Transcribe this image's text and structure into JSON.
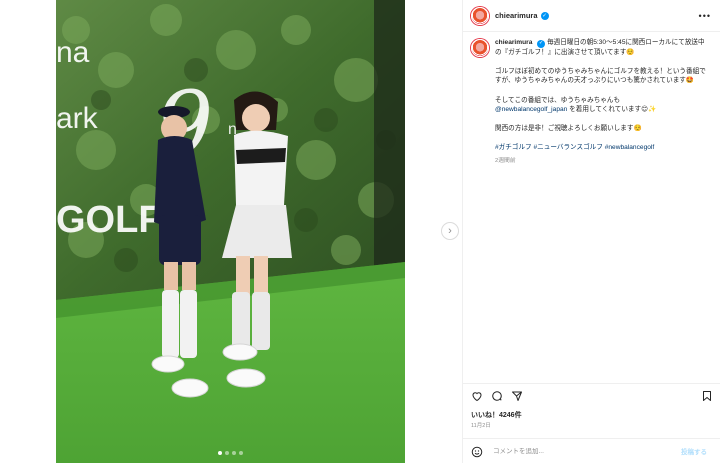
{
  "post": {
    "username": "chiearimura",
    "more_label": "•••",
    "next_label": "›",
    "media_overlay": {
      "line1": "na",
      "line2": "ark",
      "line3": "GOLF",
      "big_number": "9",
      "suffix": "n"
    },
    "carousel": {
      "count": 4,
      "active": 0
    }
  },
  "caption": {
    "username": "chiearimura",
    "line1": "毎週日曜日の朝5:30〜5:45に関西ローカルにて放送中の『ガチゴルフ！』に出演させて頂いてます☺️",
    "para2": "ゴルフほぼ初めてのゆうちゃみちゃんにゴルフを教える！という番組ですが、ゆうちゃみちゃんの天才っぷりにいつも驚かされています🤩",
    "para3_a": "そしてこの番組では、ゆうちゃみちゃんも",
    "para3_mention": "@newbalancegolf_japan",
    "para3_b": " を着用してくれています😊✨",
    "para4": "関西の方は是非！ご視聴よろしくお願いします☺️",
    "tags": "#ガチゴルフ #ニューバランスゴルフ #newbalancegolf",
    "time": "2週間前"
  },
  "footer": {
    "likes": "いいね！4246件",
    "date": "11月2日",
    "comment_placeholder": "コメントを追加...",
    "post_label": "投稿する"
  }
}
